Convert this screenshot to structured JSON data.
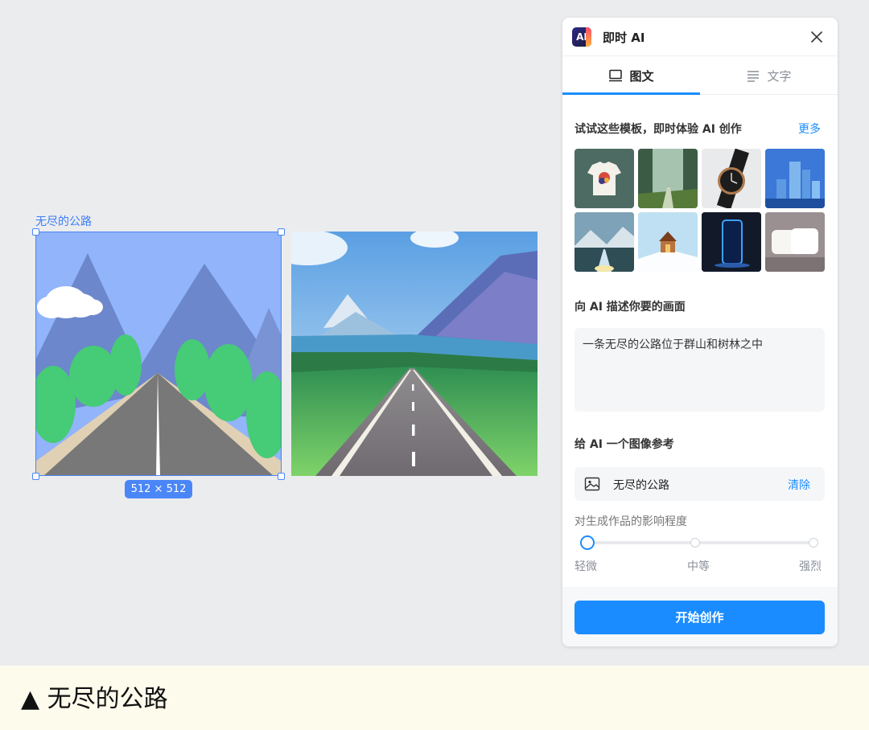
{
  "canvas": {
    "frame_label": "无尽的公路",
    "size_badge": "512 × 512"
  },
  "panel": {
    "title": "即时 AI",
    "logo_text": "AI",
    "tabs": [
      {
        "label": "图文",
        "icon": "monitor-icon",
        "active": true
      },
      {
        "label": "文字",
        "icon": "text-lines-icon",
        "active": false
      }
    ],
    "templates_title": "试试这些模板，即时体验 AI 创作",
    "templates_more": "更多",
    "templates": [
      "tshirt",
      "forest-path",
      "watch",
      "city-skyline",
      "mountain-road",
      "cabin-snow",
      "phone",
      "pillows"
    ],
    "prompt_title": "向 AI 描述你要的画面",
    "prompt_value": "一条无尽的公路位于群山和树林之中",
    "reference_title": "给 AI 一个图像参考",
    "reference_name": "无尽的公路",
    "reference_clear": "清除",
    "influence_title": "对生成作品的影响程度",
    "influence_levels": [
      "轻微",
      "中等",
      "强烈"
    ],
    "influence_value": 0,
    "start_button": "开始创作"
  },
  "caption": {
    "text": "▲ 无尽的公路"
  },
  "colors": {
    "accent": "#1a8cff",
    "selection": "#4a86f7",
    "canvas_bg": "#ebecee",
    "caption_bg": "#fdfbec"
  }
}
